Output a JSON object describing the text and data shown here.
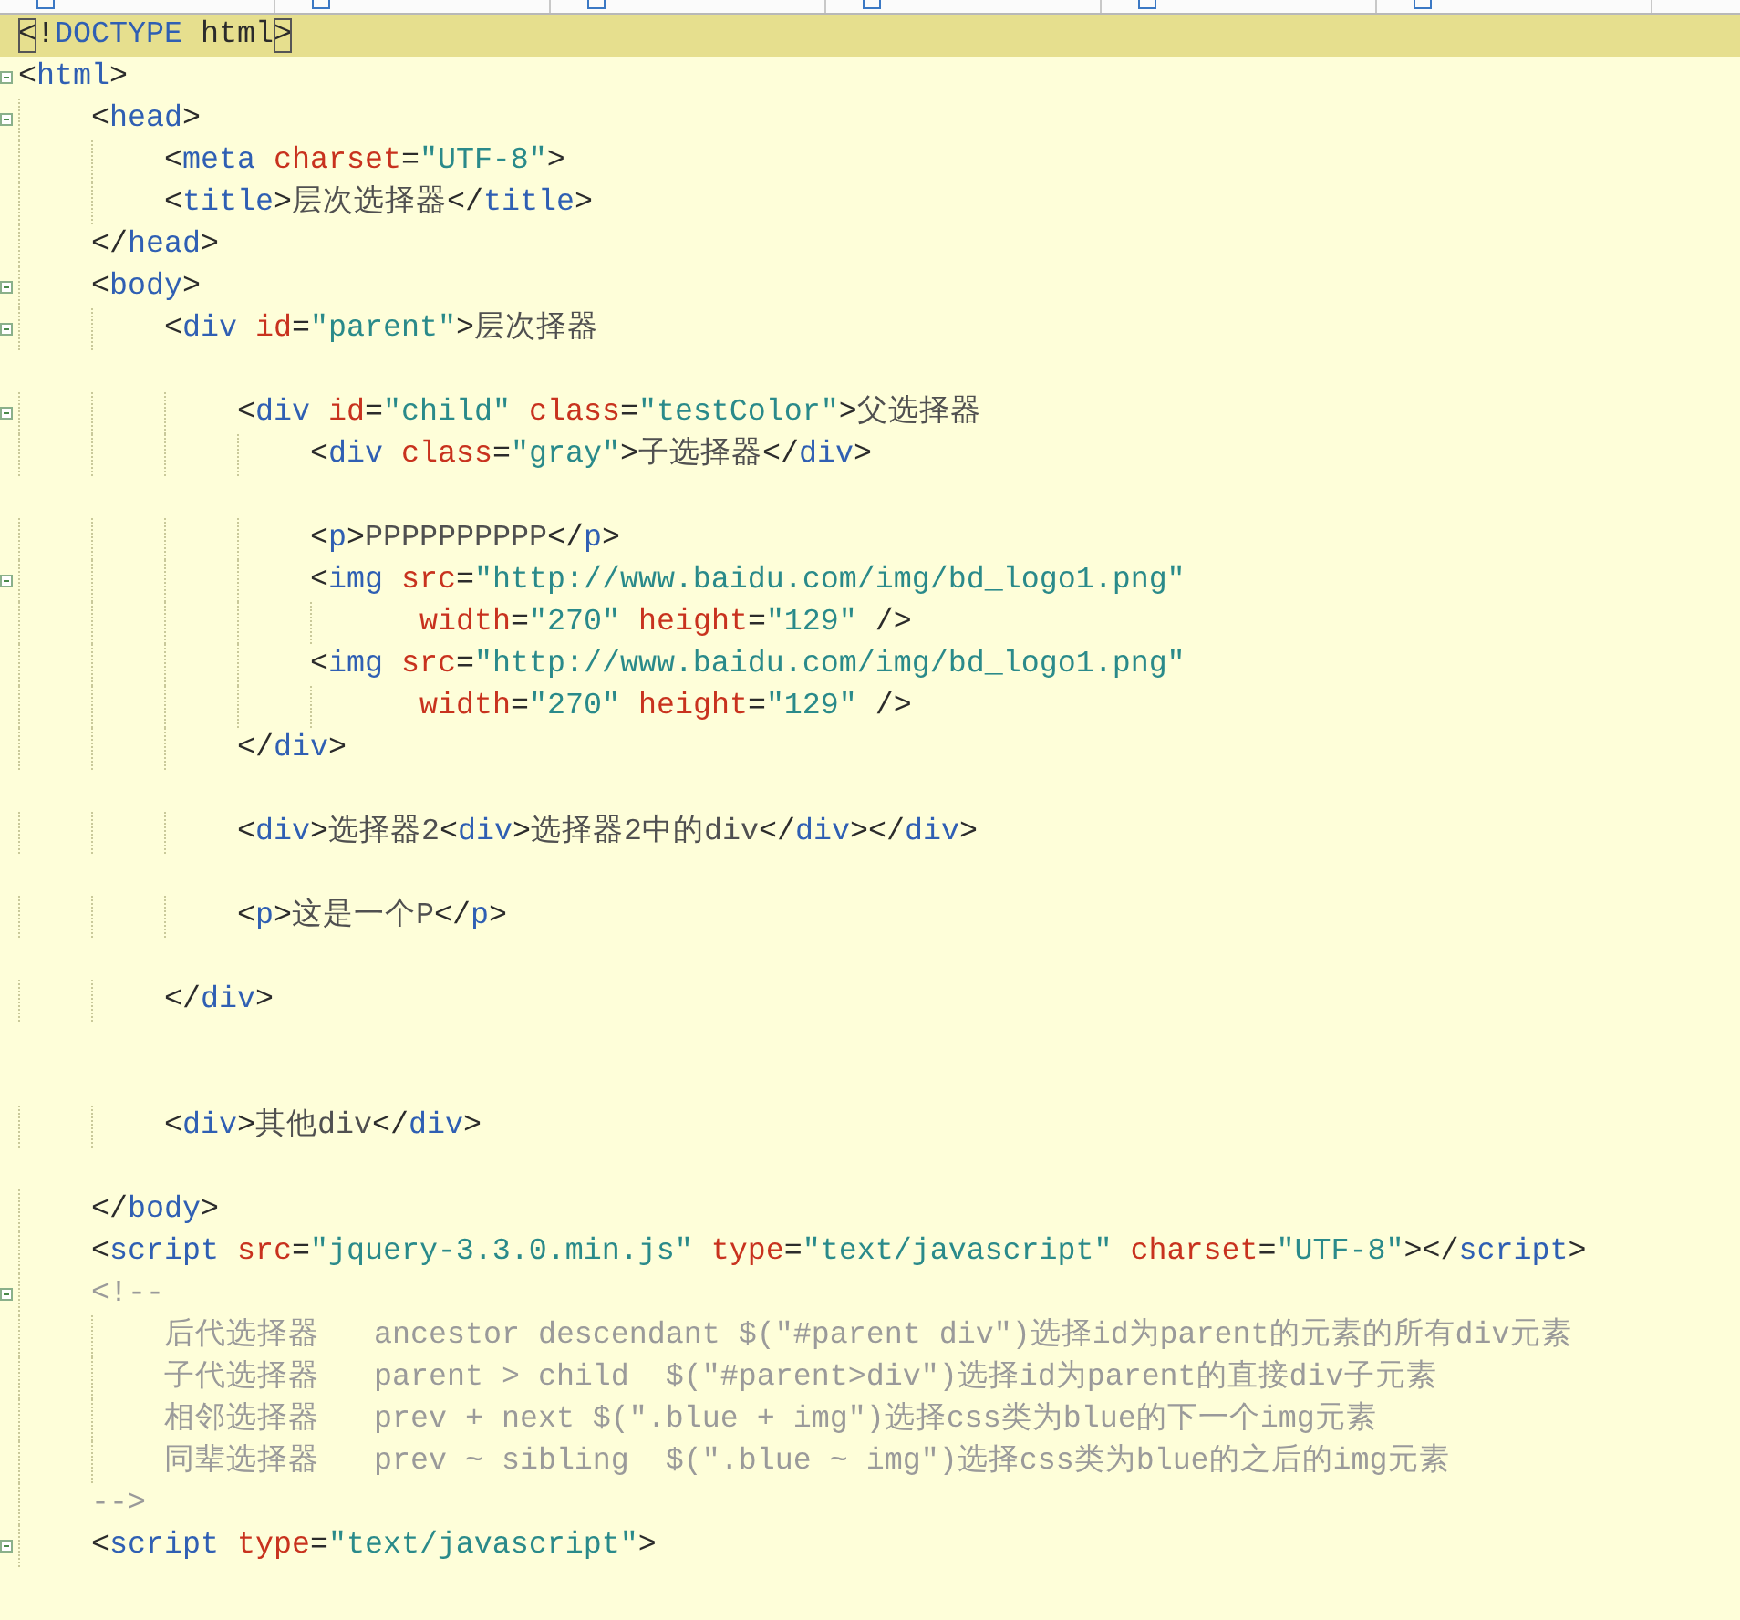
{
  "editor": {
    "lines": [
      {
        "current": true,
        "fold": false,
        "tokens": [
          {
            "kind": "punct",
            "text": "<"
          },
          {
            "kind": "punct",
            "text": "!"
          },
          {
            "kind": "tag",
            "text": "DOCTYPE"
          },
          {
            "kind": "punct",
            "text": " html"
          },
          {
            "kind": "punct",
            "text": ">"
          }
        ]
      },
      {
        "current": false,
        "fold": true,
        "tokens": [
          {
            "kind": "punct",
            "text": "<"
          },
          {
            "kind": "tag",
            "text": "html"
          },
          {
            "kind": "punct",
            "text": ">"
          }
        ]
      },
      {
        "current": false,
        "fold": true,
        "tokens": [
          {
            "kind": "punct",
            "text": "    <"
          },
          {
            "kind": "tag",
            "text": "head"
          },
          {
            "kind": "punct",
            "text": ">"
          }
        ]
      },
      {
        "current": false,
        "fold": false,
        "tokens": [
          {
            "kind": "punct",
            "text": "        <"
          },
          {
            "kind": "tag",
            "text": "meta"
          },
          {
            "kind": "attr",
            "text": " charset"
          },
          {
            "kind": "punct",
            "text": "="
          },
          {
            "kind": "value",
            "text": "\"UTF-8\""
          },
          {
            "kind": "punct",
            "text": ">"
          }
        ]
      },
      {
        "current": false,
        "fold": false,
        "tokens": [
          {
            "kind": "punct",
            "text": "        <"
          },
          {
            "kind": "tag",
            "text": "title"
          },
          {
            "kind": "punct",
            "text": ">"
          },
          {
            "kind": "text",
            "text": "层次选择器"
          },
          {
            "kind": "punct",
            "text": "</"
          },
          {
            "kind": "tag",
            "text": "title"
          },
          {
            "kind": "punct",
            "text": ">"
          }
        ]
      },
      {
        "current": false,
        "fold": false,
        "tokens": [
          {
            "kind": "punct",
            "text": "    </"
          },
          {
            "kind": "tag",
            "text": "head"
          },
          {
            "kind": "punct",
            "text": ">"
          }
        ]
      },
      {
        "current": false,
        "fold": true,
        "tokens": [
          {
            "kind": "punct",
            "text": "    <"
          },
          {
            "kind": "tag",
            "text": "body"
          },
          {
            "kind": "punct",
            "text": ">"
          }
        ]
      },
      {
        "current": false,
        "fold": true,
        "tokens": [
          {
            "kind": "punct",
            "text": "        <"
          },
          {
            "kind": "tag",
            "text": "div"
          },
          {
            "kind": "attr",
            "text": " id"
          },
          {
            "kind": "punct",
            "text": "="
          },
          {
            "kind": "value",
            "text": "\"parent\""
          },
          {
            "kind": "punct",
            "text": ">"
          },
          {
            "kind": "text",
            "text": "层次择器"
          }
        ]
      },
      {
        "current": false,
        "fold": false
      },
      {
        "current": false,
        "fold": true,
        "tokens": [
          {
            "kind": "punct",
            "text": "            <"
          },
          {
            "kind": "tag",
            "text": "div"
          },
          {
            "kind": "attr",
            "text": " id"
          },
          {
            "kind": "punct",
            "text": "="
          },
          {
            "kind": "value",
            "text": "\"child\""
          },
          {
            "kind": "attr",
            "text": " class"
          },
          {
            "kind": "punct",
            "text": "="
          },
          {
            "kind": "value",
            "text": "\"testColor\""
          },
          {
            "kind": "punct",
            "text": ">"
          },
          {
            "kind": "text",
            "text": "父选择器"
          }
        ]
      },
      {
        "current": false,
        "fold": false,
        "tokens": [
          {
            "kind": "punct",
            "text": "                <"
          },
          {
            "kind": "tag",
            "text": "div"
          },
          {
            "kind": "attr",
            "text": " class"
          },
          {
            "kind": "punct",
            "text": "="
          },
          {
            "kind": "value",
            "text": "\"gray\""
          },
          {
            "kind": "punct",
            "text": ">"
          },
          {
            "kind": "text",
            "text": "子选择器"
          },
          {
            "kind": "punct",
            "text": "</"
          },
          {
            "kind": "tag",
            "text": "div"
          },
          {
            "kind": "punct",
            "text": ">"
          }
        ]
      },
      {
        "current": false,
        "fold": false
      },
      {
        "current": false,
        "fold": false,
        "tokens": [
          {
            "kind": "punct",
            "text": "                <"
          },
          {
            "kind": "tag",
            "text": "p"
          },
          {
            "kind": "punct",
            "text": ">"
          },
          {
            "kind": "text",
            "text": "PPPPPPPPPP"
          },
          {
            "kind": "punct",
            "text": "</"
          },
          {
            "kind": "tag",
            "text": "p"
          },
          {
            "kind": "punct",
            "text": ">"
          }
        ]
      },
      {
        "current": false,
        "fold": true,
        "tokens": [
          {
            "kind": "punct",
            "text": "                <"
          },
          {
            "kind": "tag",
            "text": "img"
          },
          {
            "kind": "attr",
            "text": " src"
          },
          {
            "kind": "punct",
            "text": "="
          },
          {
            "kind": "value",
            "text": "\"http://www.baidu.com/img/bd_logo1.png\""
          }
        ]
      },
      {
        "current": false,
        "fold": false,
        "tokens": [
          {
            "kind": "attr",
            "text": "                      width"
          },
          {
            "kind": "punct",
            "text": "="
          },
          {
            "kind": "value",
            "text": "\"270\""
          },
          {
            "kind": "attr",
            "text": " height"
          },
          {
            "kind": "punct",
            "text": "="
          },
          {
            "kind": "value",
            "text": "\"129\""
          },
          {
            "kind": "punct",
            "text": " />"
          }
        ]
      },
      {
        "current": false,
        "fold": false,
        "tokens": [
          {
            "kind": "punct",
            "text": "                <"
          },
          {
            "kind": "tag",
            "text": "img"
          },
          {
            "kind": "attr",
            "text": " src"
          },
          {
            "kind": "punct",
            "text": "="
          },
          {
            "kind": "value",
            "text": "\"http://www.baidu.com/img/bd_logo1.png\""
          }
        ]
      },
      {
        "current": false,
        "fold": false,
        "tokens": [
          {
            "kind": "attr",
            "text": "                      width"
          },
          {
            "kind": "punct",
            "text": "="
          },
          {
            "kind": "value",
            "text": "\"270\""
          },
          {
            "kind": "attr",
            "text": " height"
          },
          {
            "kind": "punct",
            "text": "="
          },
          {
            "kind": "value",
            "text": "\"129\""
          },
          {
            "kind": "punct",
            "text": " />"
          }
        ]
      },
      {
        "current": false,
        "fold": false,
        "tokens": [
          {
            "kind": "punct",
            "text": "            </"
          },
          {
            "kind": "tag",
            "text": "div"
          },
          {
            "kind": "punct",
            "text": ">"
          }
        ]
      },
      {
        "current": false,
        "fold": false
      },
      {
        "current": false,
        "fold": false,
        "tokens": [
          {
            "kind": "punct",
            "text": "            <"
          },
          {
            "kind": "tag",
            "text": "div"
          },
          {
            "kind": "punct",
            "text": ">"
          },
          {
            "kind": "text",
            "text": "选择器2"
          },
          {
            "kind": "punct",
            "text": "<"
          },
          {
            "kind": "tag",
            "text": "div"
          },
          {
            "kind": "punct",
            "text": ">"
          },
          {
            "kind": "text",
            "text": "选择器2中的div"
          },
          {
            "kind": "punct",
            "text": "</"
          },
          {
            "kind": "tag",
            "text": "div"
          },
          {
            "kind": "punct",
            "text": "></"
          },
          {
            "kind": "tag",
            "text": "div"
          },
          {
            "kind": "punct",
            "text": ">"
          }
        ]
      },
      {
        "current": false,
        "fold": false
      },
      {
        "current": false,
        "fold": false,
        "tokens": [
          {
            "kind": "punct",
            "text": "            <"
          },
          {
            "kind": "tag",
            "text": "p"
          },
          {
            "kind": "punct",
            "text": ">"
          },
          {
            "kind": "text",
            "text": "这是一个P"
          },
          {
            "kind": "punct",
            "text": "</"
          },
          {
            "kind": "tag",
            "text": "p"
          },
          {
            "kind": "punct",
            "text": ">"
          }
        ]
      },
      {
        "current": false,
        "fold": false
      },
      {
        "current": false,
        "fold": false,
        "tokens": [
          {
            "kind": "punct",
            "text": "        </"
          },
          {
            "kind": "tag",
            "text": "div"
          },
          {
            "kind": "punct",
            "text": ">"
          }
        ]
      },
      {
        "current": false,
        "fold": false
      },
      {
        "current": false,
        "fold": false
      },
      {
        "current": false,
        "fold": false,
        "tokens": [
          {
            "kind": "punct",
            "text": "        <"
          },
          {
            "kind": "tag",
            "text": "div"
          },
          {
            "kind": "punct",
            "text": ">"
          },
          {
            "kind": "text",
            "text": "其他div"
          },
          {
            "kind": "punct",
            "text": "</"
          },
          {
            "kind": "tag",
            "text": "div"
          },
          {
            "kind": "punct",
            "text": ">"
          }
        ]
      },
      {
        "current": false,
        "fold": false
      },
      {
        "current": false,
        "fold": false,
        "tokens": [
          {
            "kind": "punct",
            "text": "    </"
          },
          {
            "kind": "tag",
            "text": "body"
          },
          {
            "kind": "punct",
            "text": ">"
          }
        ]
      },
      {
        "current": false,
        "fold": false,
        "tokens": [
          {
            "kind": "punct",
            "text": "    <"
          },
          {
            "kind": "tag",
            "text": "script"
          },
          {
            "kind": "attr",
            "text": " src"
          },
          {
            "kind": "punct",
            "text": "="
          },
          {
            "kind": "value",
            "text": "\"jquery-3.3.0.min.js\""
          },
          {
            "kind": "attr",
            "text": " type"
          },
          {
            "kind": "punct",
            "text": "="
          },
          {
            "kind": "value",
            "text": "\"text/javascript\""
          },
          {
            "kind": "attr",
            "text": " charset"
          },
          {
            "kind": "punct",
            "text": "="
          },
          {
            "kind": "value",
            "text": "\"UTF-8\""
          },
          {
            "kind": "punct",
            "text": "></"
          },
          {
            "kind": "tag",
            "text": "script"
          },
          {
            "kind": "punct",
            "text": ">"
          }
        ]
      },
      {
        "current": false,
        "fold": true,
        "tokens": [
          {
            "kind": "comment",
            "text": "    <!--"
          }
        ]
      },
      {
        "current": false,
        "fold": false,
        "tokens": [
          {
            "kind": "comment",
            "text": "        后代选择器   ancestor descendant $(\"#parent div\")选择id为parent的元素的所有div元素"
          }
        ]
      },
      {
        "current": false,
        "fold": false,
        "tokens": [
          {
            "kind": "comment",
            "text": "        子代选择器   parent > child  $(\"#parent>div\")选择id为parent的直接div子元素"
          }
        ]
      },
      {
        "current": false,
        "fold": false,
        "tokens": [
          {
            "kind": "comment",
            "text": "        相邻选择器   prev + next $(\".blue + img\")选择css类为blue的下一个img元素"
          }
        ]
      },
      {
        "current": false,
        "fold": false,
        "tokens": [
          {
            "kind": "comment",
            "text": "        同辈选择器   prev ~ sibling  $(\".blue ~ img\")选择css类为blue的之后的img元素"
          }
        ]
      },
      {
        "current": false,
        "fold": false,
        "tokens": [
          {
            "kind": "comment",
            "text": "    -->"
          }
        ]
      },
      {
        "current": false,
        "fold": true,
        "tokens": [
          {
            "kind": "punct",
            "text": "    <"
          },
          {
            "kind": "tag",
            "text": "script"
          },
          {
            "kind": "attr",
            "text": " type"
          },
          {
            "kind": "punct",
            "text": "="
          },
          {
            "kind": "value",
            "text": "\"text/javascript\""
          },
          {
            "kind": "punct",
            "text": ">"
          }
        ]
      },
      {
        "current": false,
        "fold": false
      }
    ]
  }
}
